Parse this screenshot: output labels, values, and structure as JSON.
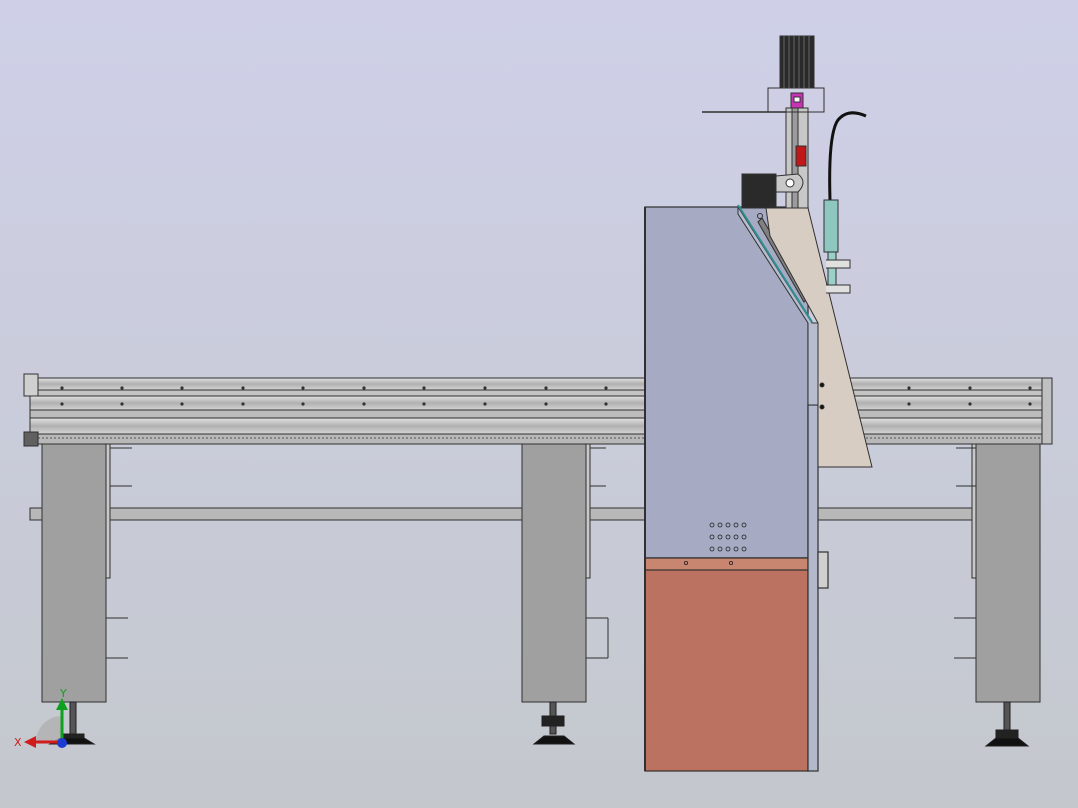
{
  "viewport": {
    "bg_top": "#cfd0e8",
    "bg_bottom": "#c4c8cd"
  },
  "colors": {
    "steel": "#a0a0a0",
    "steel_light": "#c8c8c8",
    "rail": "#b4b4b4",
    "panel": "#a6abc3",
    "copper": "#bc7260",
    "copper_top": "#c88670",
    "bracket": "#d8cdc3",
    "motor": "#2a2a2a",
    "torch": "#8ec6c0",
    "magenta": "#c832b4",
    "red_part": "#c01818",
    "outline": "#303030"
  },
  "triad": {
    "x_label": "X",
    "y_label": "Y",
    "x_color": "#d01c1c",
    "y_color": "#10a020",
    "z_color": "#1c3cd0"
  }
}
